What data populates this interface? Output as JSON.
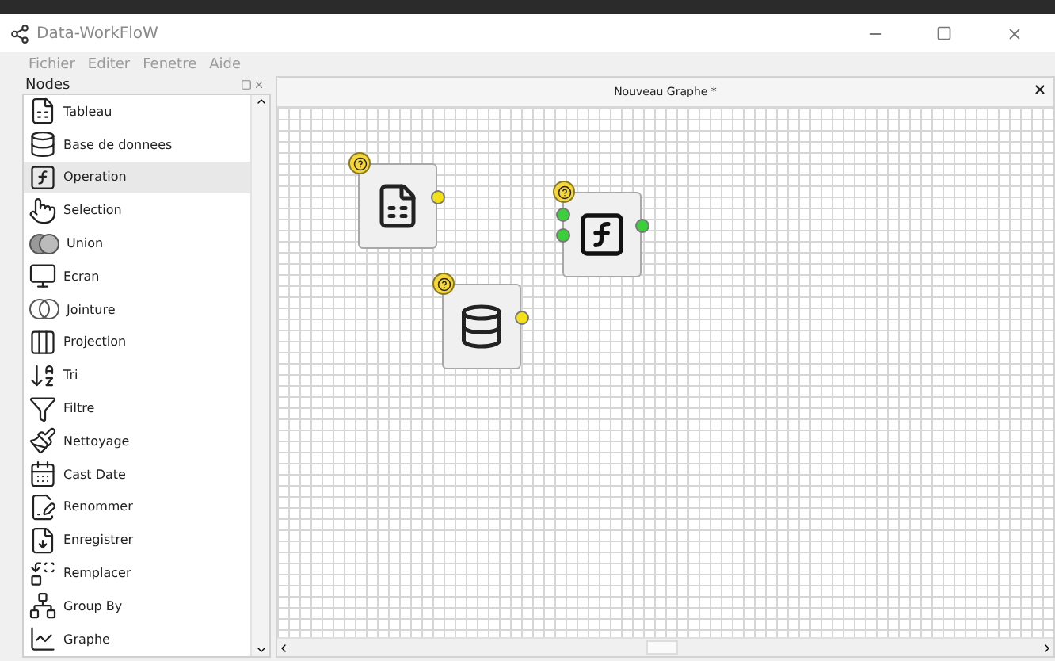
{
  "window": {
    "title": "Data-WorkFloW"
  },
  "menu": [
    "Fichier",
    "Editer",
    "Fenetre",
    "Aide"
  ],
  "nodes_panel": {
    "title": "Nodes",
    "items": [
      {
        "label": "Tableau",
        "selected": false
      },
      {
        "label": "Base de donnees",
        "selected": false
      },
      {
        "label": "Operation",
        "selected": true
      },
      {
        "label": "Selection",
        "selected": false
      },
      {
        "label": "Union",
        "selected": false
      },
      {
        "label": "Ecran",
        "selected": false
      },
      {
        "label": "Jointure",
        "selected": false
      },
      {
        "label": "Projection",
        "selected": false
      },
      {
        "label": "Tri",
        "selected": false
      },
      {
        "label": "Filtre",
        "selected": false
      },
      {
        "label": "Nettoyage",
        "selected": false
      },
      {
        "label": "Cast Date",
        "selected": false
      },
      {
        "label": "Renommer",
        "selected": false
      },
      {
        "label": "Enregistrer",
        "selected": false
      },
      {
        "label": "Remplacer",
        "selected": false
      },
      {
        "label": "Group By",
        "selected": false
      },
      {
        "label": "Graphe",
        "selected": false
      }
    ]
  },
  "editor": {
    "tab_title": "Nouveau Graphe *",
    "nodes": [
      {
        "kind": "table"
      },
      {
        "kind": "database"
      },
      {
        "kind": "function"
      }
    ]
  }
}
